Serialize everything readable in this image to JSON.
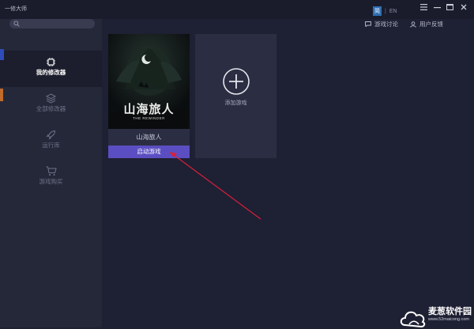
{
  "window": {
    "title": "一修大师",
    "lang_active": "简",
    "lang_separator": "|",
    "lang_other": "EN",
    "menu_icon": "menu-icon",
    "minimize_icon": "minimize-icon",
    "close_icon": "close-icon"
  },
  "topnav": {
    "discussion": "游戏讨论",
    "feedback": "用户反馈"
  },
  "sidebar": {
    "search_placeholder": "",
    "items": [
      {
        "label": "我的修改器",
        "icon": "chip-icon",
        "active": true
      },
      {
        "label": "全部修改器",
        "icon": "layers-icon",
        "active": false
      },
      {
        "label": "运行库",
        "icon": "rocket-icon",
        "active": false
      },
      {
        "label": "游戏购买",
        "icon": "cart-icon",
        "active": false
      }
    ]
  },
  "games": [
    {
      "name": "山海旅人",
      "cover_title": "山海旅人",
      "cover_subtitle": "THE REWINDER",
      "launch_label": "启动游戏"
    }
  ],
  "add_card": {
    "label": "添加游戏",
    "icon": "plus-circle-icon"
  },
  "watermark": {
    "brand": "麦葱软件园",
    "url": "www.52maicong.com"
  },
  "colors": {
    "background": "#1e2033",
    "sidebar": "#252839",
    "card": "#2b2e42",
    "launch_button": "#5b4ec2",
    "annotation_arrow": "#d8203a",
    "lang_active": "#2f6fb3"
  }
}
